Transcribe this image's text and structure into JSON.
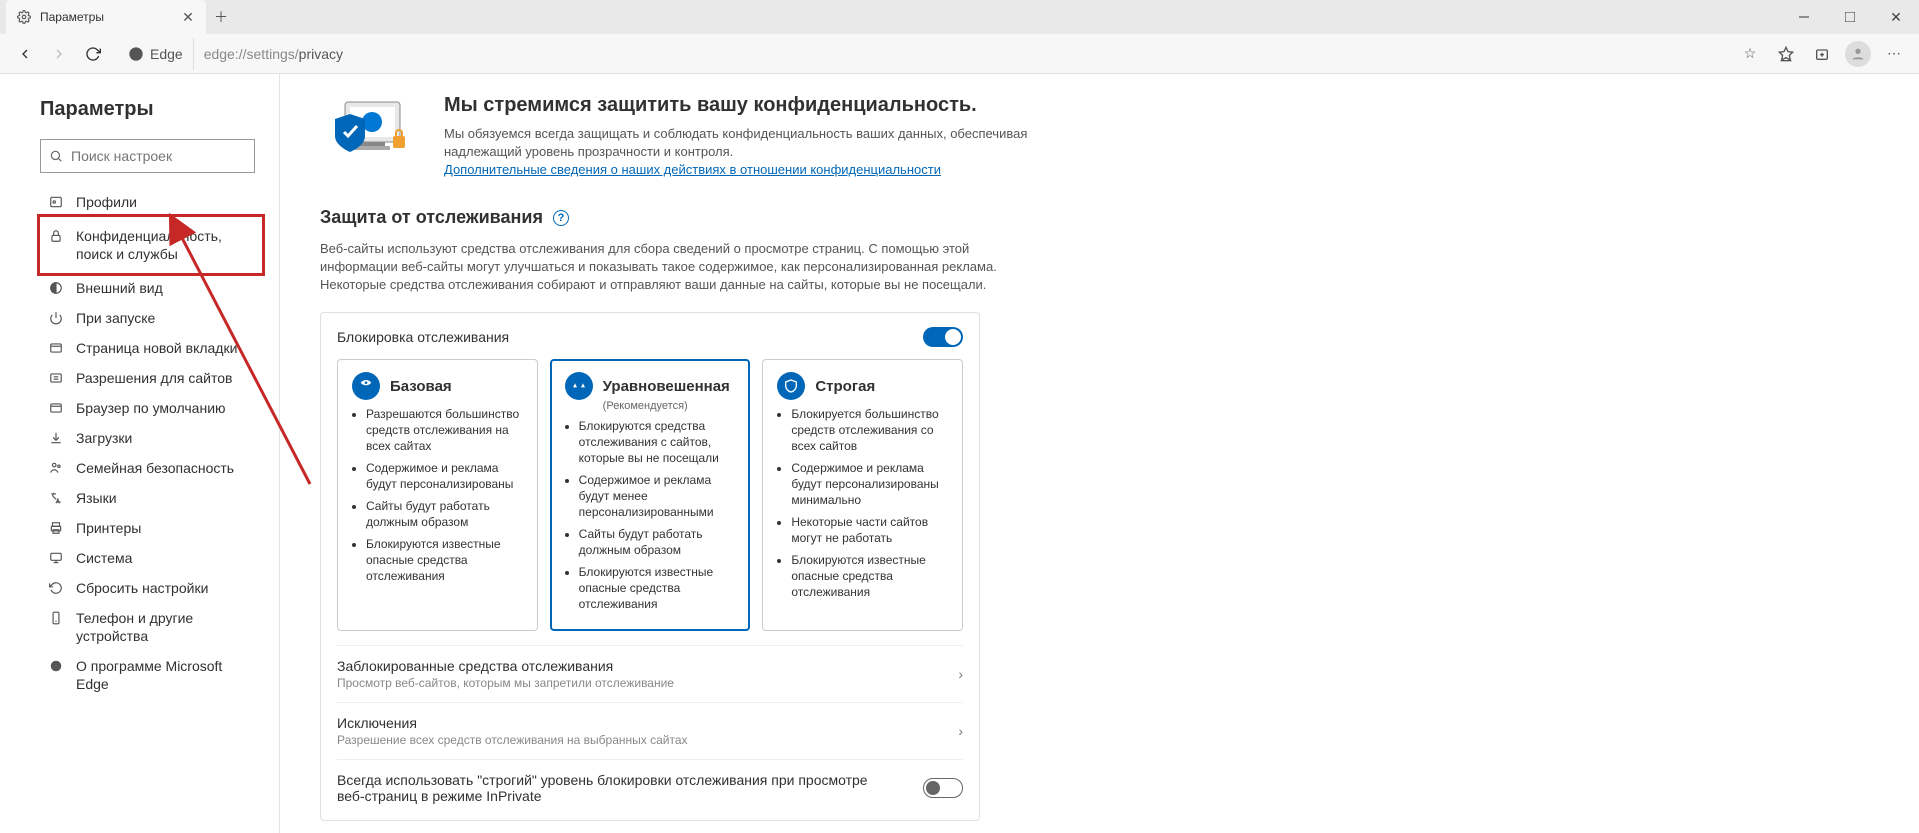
{
  "window": {
    "tab_title": "Параметры"
  },
  "toolbar": {
    "edge_label": "Edge",
    "url_gray": "edge://settings/",
    "url_dark": "privacy"
  },
  "sidebar": {
    "title": "Параметры",
    "search_placeholder": "Поиск настроек",
    "items": [
      {
        "label": "Профили"
      },
      {
        "label": "Конфиденциальность, поиск и службы"
      },
      {
        "label": "Внешний вид"
      },
      {
        "label": "При запуске"
      },
      {
        "label": "Страница новой вкладки"
      },
      {
        "label": "Разрешения для сайтов"
      },
      {
        "label": "Браузер по умолчанию"
      },
      {
        "label": "Загрузки"
      },
      {
        "label": "Семейная безопасность"
      },
      {
        "label": "Языки"
      },
      {
        "label": "Принтеры"
      },
      {
        "label": "Система"
      },
      {
        "label": "Сбросить настройки"
      },
      {
        "label": "Телефон и другие устройства"
      },
      {
        "label": "О программе Microsoft Edge"
      }
    ]
  },
  "hero": {
    "title": "Мы стремимся защитить вашу конфиденциальность.",
    "text": "Мы обязуемся всегда защищать и соблюдать конфиденциальность ваших данных, обеспечивая надлежащий уровень прозрачности и контроля.",
    "link": "Дополнительные сведения о наших действиях в отношении конфиденциальности"
  },
  "tracking": {
    "title": "Защита от отслеживания",
    "desc": "Веб-сайты используют средства отслеживания для сбора сведений о просмотре страниц. С помощью этой информации веб-сайты могут улучшаться и показывать такое содержимое, как персонализированная реклама. Некоторые средства отслеживания собирают и отправляют ваши данные на сайты, которые вы не посещали.",
    "block_label": "Блокировка отслеживания",
    "cards": [
      {
        "title": "Базовая",
        "bullets": [
          "Разрешаются большинство средств отслеживания на всех сайтах",
          "Содержимое и реклама будут персонализированы",
          "Сайты будут работать должным образом",
          "Блокируются известные опасные средства отслеживания"
        ]
      },
      {
        "title": "Уравновешенная",
        "rec": "(Рекомендуется)",
        "bullets": [
          "Блокируются средства отслеживания с сайтов, которые вы не посещали",
          "Содержимое и реклама будут менее персонализированными",
          "Сайты будут работать должным образом",
          "Блокируются известные опасные средства отслеживания"
        ]
      },
      {
        "title": "Строгая",
        "bullets": [
          "Блокируется большинство средств отслеживания со всех сайтов",
          "Содержимое и реклама будут персонализированы минимально",
          "Некоторые части сайтов могут не работать",
          "Блокируются известные опасные средства отслеживания"
        ]
      }
    ],
    "blocked": {
      "title": "Заблокированные средства отслеживания",
      "sub": "Просмотр веб-сайтов, которым мы запретили отслеживание"
    },
    "exceptions": {
      "title": "Исключения",
      "sub": "Разрешение всех средств отслеживания на выбранных сайтах"
    },
    "inprivate": "Всегда использовать \"строгий\" уровень блокировки отслеживания при просмотре веб-страниц в режиме InPrivate"
  }
}
